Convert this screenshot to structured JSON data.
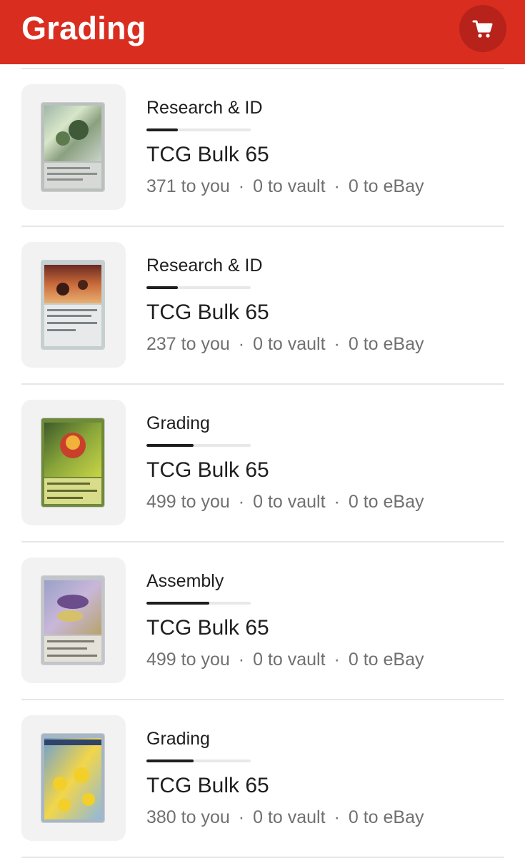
{
  "header": {
    "title": "Grading",
    "cart_icon": "cart-icon",
    "background_color": "#d92d20"
  },
  "orders": [
    {
      "stage": "Research & ID",
      "progress": 0.3,
      "title": "TCG Bulk 65",
      "to_you": "371 to you",
      "to_vault": "0 to vault",
      "to_ebay": "0 to eBay",
      "separator": "·",
      "thumbnail": "trading-card-thumbnail"
    },
    {
      "stage": "Research & ID",
      "progress": 0.3,
      "title": "TCG Bulk 65",
      "to_you": "237 to you",
      "to_vault": "0 to vault",
      "to_ebay": "0 to eBay",
      "separator": "·",
      "thumbnail": "trading-card-thumbnail"
    },
    {
      "stage": "Grading",
      "progress": 0.45,
      "title": "TCG Bulk 65",
      "to_you": "499 to you",
      "to_vault": "0 to vault",
      "to_ebay": "0 to eBay",
      "separator": "·",
      "thumbnail": "trading-card-thumbnail"
    },
    {
      "stage": "Assembly",
      "progress": 0.6,
      "title": "TCG Bulk 65",
      "to_you": "499 to you",
      "to_vault": "0 to vault",
      "to_ebay": "0 to eBay",
      "separator": "·",
      "thumbnail": "trading-card-thumbnail"
    },
    {
      "stage": "Grading",
      "progress": 0.45,
      "title": "TCG Bulk 65",
      "to_you": "380 to you",
      "to_vault": "0 to vault",
      "to_ebay": "0 to eBay",
      "separator": "·",
      "thumbnail": "trading-card-thumbnail"
    }
  ]
}
